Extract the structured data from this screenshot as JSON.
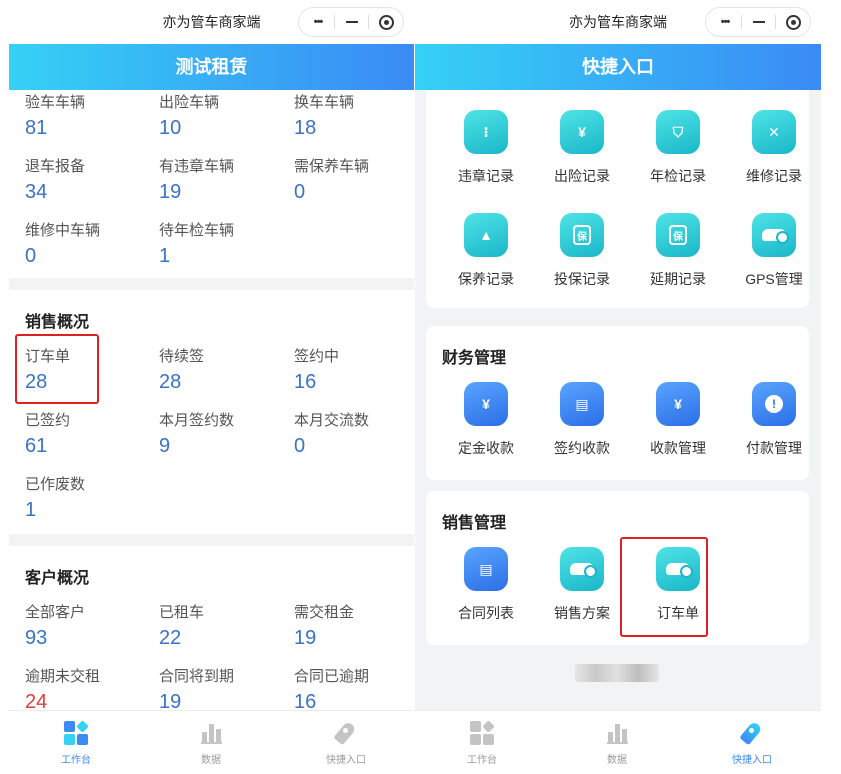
{
  "left": {
    "app_title": "亦为管车商家端",
    "page_title": "测试租赁",
    "vehicle_stats": [
      {
        "label": "验车车辆",
        "value": "81"
      },
      {
        "label": "出险车辆",
        "value": "10"
      },
      {
        "label": "换车车辆",
        "value": "18"
      },
      {
        "label": "退车报备",
        "value": "34"
      },
      {
        "label": "有违章车辆",
        "value": "19"
      },
      {
        "label": "需保养车辆",
        "value": "0"
      },
      {
        "label": "维修中车辆",
        "value": "0"
      },
      {
        "label": "待年检车辆",
        "value": "1"
      }
    ],
    "sales_title": "销售概况",
    "sales_stats": [
      {
        "label": "订车单",
        "value": "28"
      },
      {
        "label": "待续签",
        "value": "28"
      },
      {
        "label": "签约中",
        "value": "16"
      },
      {
        "label": "已签约",
        "value": "61"
      },
      {
        "label": "本月签约数",
        "value": "9"
      },
      {
        "label": "本月交流数",
        "value": "0"
      },
      {
        "label": "已作废数",
        "value": "1"
      }
    ],
    "customer_title": "客户概况",
    "customer_stats": [
      {
        "label": "全部客户",
        "value": "93"
      },
      {
        "label": "已租车",
        "value": "22"
      },
      {
        "label": "需交租金",
        "value": "19"
      },
      {
        "label": "逾期未交租",
        "value": "24"
      },
      {
        "label": "合同将到期",
        "value": "19"
      },
      {
        "label": "合同已逾期",
        "value": "16"
      }
    ]
  },
  "right": {
    "app_title": "亦为管车商家端",
    "page_title": "快捷入口",
    "vehicle_section": {
      "items": [
        {
          "label": "违章记录",
          "icon": "traffic-light-icon"
        },
        {
          "label": "出险记录",
          "icon": "accident-icon"
        },
        {
          "label": "年检记录",
          "icon": "inspection-shield-icon"
        },
        {
          "label": "维修记录",
          "icon": "repair-tools-icon"
        },
        {
          "label": "保养记录",
          "icon": "oil-can-icon"
        },
        {
          "label": "投保记录",
          "icon": "insurance-icon"
        },
        {
          "label": "延期记录",
          "icon": "extension-icon"
        },
        {
          "label": "GPS管理",
          "icon": "gps-car-icon"
        }
      ],
      "insurance_glyph": "保",
      "extension_glyph": "保"
    },
    "finance_section": {
      "title": "财务管理",
      "items": [
        {
          "label": "定金收款",
          "icon": "deposit-icon"
        },
        {
          "label": "签约收款",
          "icon": "contract-payment-icon"
        },
        {
          "label": "收款管理",
          "icon": "receipt-icon"
        },
        {
          "label": "付款管理",
          "icon": "payment-alert-icon"
        }
      ]
    },
    "sales_section": {
      "title": "销售管理",
      "items": [
        {
          "label": "合同列表",
          "icon": "contract-list-icon"
        },
        {
          "label": "销售方案",
          "icon": "sales-plan-car-icon"
        },
        {
          "label": "订车单",
          "icon": "order-car-icon"
        }
      ]
    }
  },
  "tabbar": {
    "tabs": [
      {
        "label": "工作台",
        "icon": "workbench-icon"
      },
      {
        "label": "数据",
        "icon": "data-chart-icon"
      },
      {
        "label": "快捷入口",
        "icon": "rocket-icon"
      }
    ]
  },
  "colors": {
    "accent_blue": "#3a8bf5",
    "header_gradient_start": "#35d1f5",
    "value_blue": "#3a72c6",
    "warning_red": "#e23b3b",
    "highlight_box": "#e02020"
  }
}
